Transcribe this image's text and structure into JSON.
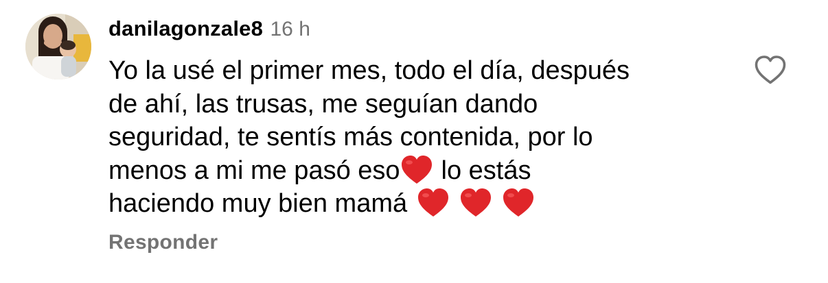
{
  "comment": {
    "username": "danilagonzale8",
    "timestamp": "16 h",
    "text_lines": [
      "Yo la usé el primer mes, todo el día, después",
      "de ahí, las trusas, me seguían dando",
      "seguridad, te sentís más contenida, por lo",
      "menos a mi me pasó eso",
      "lo estás",
      "haciendo muy bien mamá"
    ],
    "reply_label": "Responder",
    "like_icon": "heart-outline-icon",
    "emoji": "red-heart-emoji"
  },
  "colors": {
    "text": "#000000",
    "secondary": "#737373",
    "heart_red": "#e0262a",
    "icon_outline": "#737373",
    "background": "#ffffff"
  }
}
